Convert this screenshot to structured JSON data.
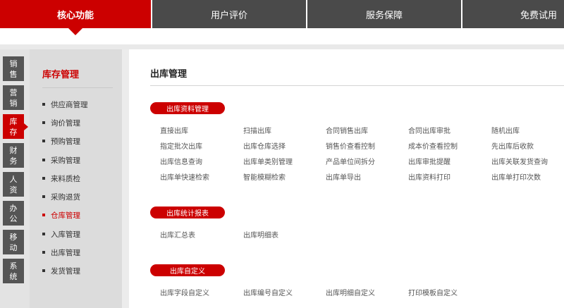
{
  "top_tabs": [
    {
      "label": "核心功能"
    },
    {
      "label": "用户评价"
    },
    {
      "label": "服务保障"
    },
    {
      "label": "免费试用"
    }
  ],
  "left_nav": [
    {
      "label": "销售"
    },
    {
      "label": "营销"
    },
    {
      "label": "库存"
    },
    {
      "label": "财务"
    },
    {
      "label": "人资"
    },
    {
      "label": "办公"
    },
    {
      "label": "移动"
    },
    {
      "label": "系统"
    }
  ],
  "submenu": {
    "title": "库存管理",
    "items": [
      {
        "label": "供应商管理"
      },
      {
        "label": "询价管理"
      },
      {
        "label": "预购管理"
      },
      {
        "label": "采购管理"
      },
      {
        "label": "来料质检"
      },
      {
        "label": "采购退货"
      },
      {
        "label": "仓库管理"
      },
      {
        "label": "入库管理"
      },
      {
        "label": "出库管理"
      },
      {
        "label": "发货管理"
      }
    ]
  },
  "main": {
    "title": "出库管理",
    "sections": [
      {
        "label": "出库资料管理",
        "links": [
          "直接出库",
          "扫描出库",
          "合同销售出库",
          "合同出库审批",
          "随机出库",
          "指定批次出库",
          "出库仓库选择",
          "销售价查看控制",
          "成本价查看控制",
          "先出库后收款",
          "出库信息查询",
          "出库单类别管理",
          "产品单位间拆分",
          "出库审批提醒",
          "出库关联发货查询",
          "出库单快速检索",
          "智能模糊检索",
          "出库单导出",
          "出库资料打印",
          "出库单打印次数"
        ]
      },
      {
        "label": "出库统计报表",
        "links": [
          "出库汇总表",
          "出库明细表"
        ]
      },
      {
        "label": "出库自定义",
        "links": [
          "出库字段自定义",
          "出库编号自定义",
          "出库明细自定义",
          "打印模板自定义"
        ]
      }
    ]
  },
  "colors": {
    "accent": "#cc0000",
    "tab_bg": "#4a4a4a",
    "nav_bg": "#555555"
  }
}
